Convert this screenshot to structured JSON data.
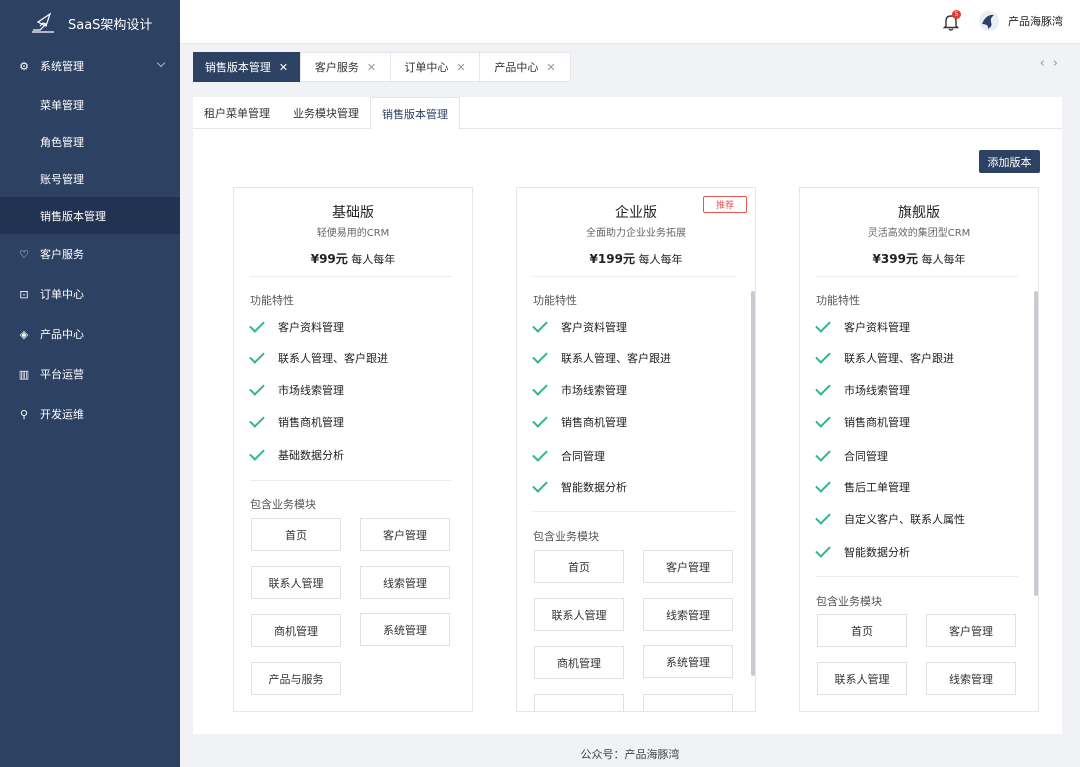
{
  "app": {
    "title": "SaaS架构设计"
  },
  "sidebar": {
    "system": "系统管理",
    "sub": [
      "菜单管理",
      "角色管理",
      "账号管理",
      "销售版本管理"
    ],
    "groups": [
      "客户服务",
      "订单中心",
      "产品中心",
      "平台运营",
      "开发运维"
    ]
  },
  "header": {
    "notifications": "5",
    "user": "产品海豚湾"
  },
  "tabs": [
    {
      "label": "销售版本管理"
    },
    {
      "label": "客户服务"
    },
    {
      "label": "订单中心"
    },
    {
      "label": "产品中心"
    }
  ],
  "subtabs": [
    "租户菜单管理",
    "业务模块管理",
    "销售版本管理"
  ],
  "add_button": "添加版本",
  "plans": [
    {
      "name": "基础版",
      "desc": "轻便易用的CRM",
      "price": "¥99元",
      "unit": "每人每年",
      "features_label": "功能特性",
      "features": [
        "客户资料管理",
        "联系人管理、客户跟进",
        "市场线索管理",
        "销售商机管理",
        "基础数据分析"
      ],
      "modules_label": "包含业务模块",
      "modules": [
        "首页",
        "客户管理",
        "联系人管理",
        "线索管理",
        "商机管理",
        "系统管理",
        "产品与服务"
      ]
    },
    {
      "name": "企业版",
      "desc": "全面助力企业业务拓展",
      "price": "¥199元",
      "unit": "每人每年",
      "badge": "推荐",
      "features_label": "功能特性",
      "features": [
        "客户资料管理",
        "联系人管理、客户跟进",
        "市场线索管理",
        "销售商机管理",
        "合同管理",
        "智能数据分析"
      ],
      "modules_label": "包含业务模块",
      "modules": [
        "首页",
        "客户管理",
        "联系人管理",
        "线索管理",
        "商机管理",
        "系统管理"
      ]
    },
    {
      "name": "旗舰版",
      "desc": "灵活高效的集团型CRM",
      "price": "¥399元",
      "unit": "每人每年",
      "features_label": "功能特性",
      "features": [
        "客户资料管理",
        "联系人管理、客户跟进",
        "市场线索管理",
        "销售商机管理",
        "合同管理",
        "售后工单管理",
        "自定义客户、联系人属性",
        "智能数据分析"
      ],
      "modules_label": "包含业务模块",
      "modules": [
        "首页",
        "客户管理",
        "联系人管理",
        "线索管理"
      ]
    }
  ],
  "footer": {
    "label": "公众号：",
    "name": "产品海豚湾"
  }
}
